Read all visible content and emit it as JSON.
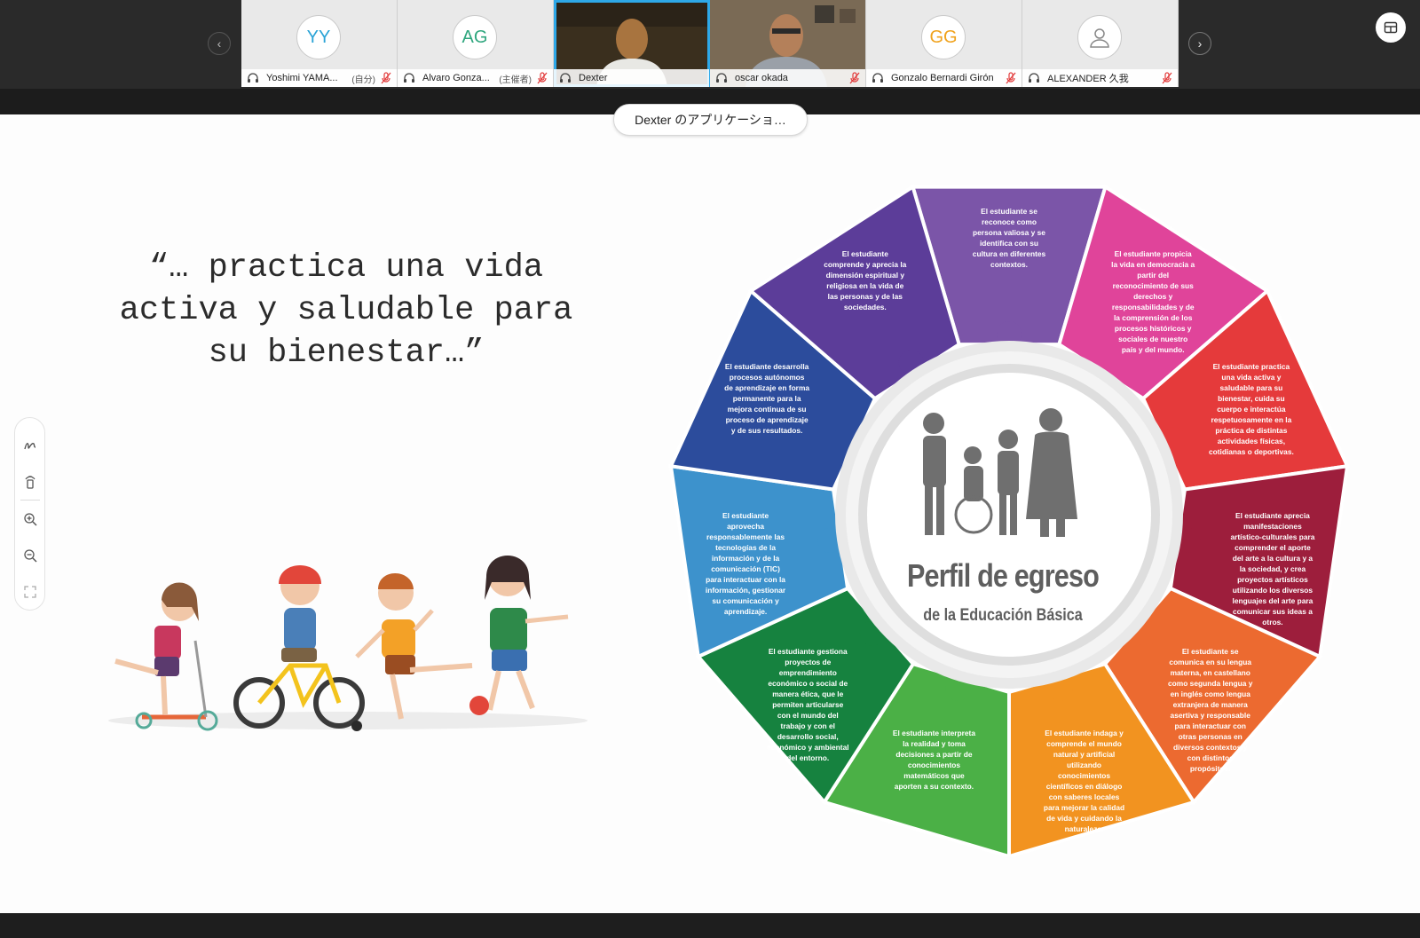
{
  "participants": [
    {
      "initials": "YY",
      "name": "Yoshimi YAMA...",
      "role": "(自分)",
      "type": "avatar",
      "muted": true
    },
    {
      "initials": "AG",
      "name": "Alvaro Gonza...",
      "role": "(主催者)",
      "type": "avatar",
      "muted": true
    },
    {
      "initials": "",
      "name": "Dexter",
      "role": "",
      "type": "video",
      "muted": false,
      "active": true
    },
    {
      "initials": "",
      "name": "oscar okada",
      "role": "",
      "type": "video",
      "muted": true
    },
    {
      "initials": "GG",
      "name": "Gonzalo Bernardi Girón",
      "role": "",
      "type": "avatar",
      "muted": true
    },
    {
      "initials": "",
      "name": "ALEXANDER 久我",
      "role": "",
      "type": "placeholder",
      "muted": true
    }
  ],
  "share_label": "Dexter のアプリケーショ…",
  "slide": {
    "quote_lines": [
      "“… practica una vida",
      "activa y saludable para",
      "su bienestar…”"
    ],
    "center_title": "Perfil de egreso",
    "center_subtitle": "de la Educación Básica",
    "segments": [
      {
        "color": "#7b55a8",
        "text": "El estudiante se reconoce como persona valiosa y se identifica con su cultura en diferentes contextos."
      },
      {
        "color": "#e0449a",
        "text": "El estudiante propicia la vida en democracia a partir del reconocimiento de sus derechos y responsabilidades y de la comprensión de los procesos históricos y sociales de nuestro país y del mundo."
      },
      {
        "color": "#e53a3b",
        "text": "El estudiante practica una vida activa y saludable para su bienestar, cuida su cuerpo e interactúa respetuosamente en la práctica de distintas actividades físicas, cotidianas o deportivas."
      },
      {
        "color": "#9d1e3c",
        "text": "El estudiante aprecia manifestaciones artístico-culturales para comprender el aporte del arte a la cultura y a la sociedad, y crea proyectos artísticos utilizando los diversos lenguajes del arte para comunicar sus ideas a otros."
      },
      {
        "color": "#ec6a30",
        "text": "El estudiante se comunica en su lengua materna, en castellano como segunda lengua y en inglés como lengua extranjera de manera asertiva y responsable para interactuar con otras personas en diversos contextos y con distintos propósitos."
      },
      {
        "color": "#f29320",
        "text": "El estudiante indaga y comprende el mundo natural y artificial utilizando conocimientos científicos en diálogo con saberes locales para mejorar la calidad de vida y cuidando la naturaleza."
      },
      {
        "color": "#4bb046",
        "text": "El estudiante interpreta la realidad y toma decisiones a partir de conocimientos matemáticos que aporten a su contexto."
      },
      {
        "color": "#16823f",
        "text": "El estudiante gestiona proyectos de emprendimiento económico o social de manera ética, que le permiten articularse con el mundo del trabajo y con el desarrollo social, económico y ambiental del entorno."
      },
      {
        "color": "#3d92cc",
        "text": "El estudiante aprovecha responsablemente las tecnologías de la información y de la comunicación (TIC) para interactuar con la información, gestionar su comunicación y aprendizaje."
      },
      {
        "color": "#2c4c9c",
        "text": "El estudiante desarrolla procesos autónomos de aprendizaje en forma permanente para la mejora continua de su proceso de aprendizaje y de sus resultados."
      },
      {
        "color": "#5c3d99",
        "text": "El estudiante comprende y aprecia la dimensión espiritual y religiosa en la vida de las personas y de las sociedades."
      }
    ]
  },
  "icons": {
    "toolbar": [
      "annotate-icon",
      "laser-icon",
      "zoom-in-icon",
      "zoom-out-icon",
      "fit-screen-icon"
    ]
  }
}
